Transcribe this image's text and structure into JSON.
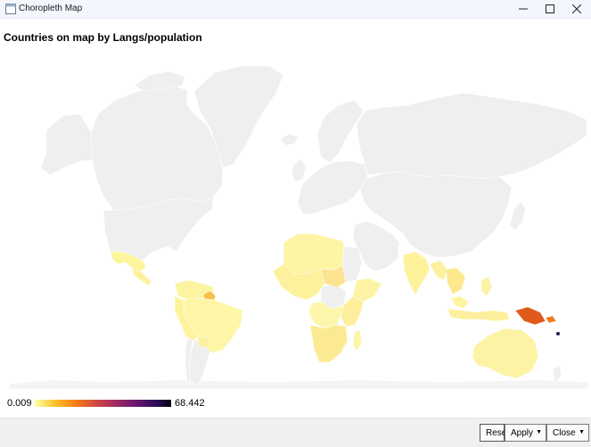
{
  "window": {
    "title": "Choropleth Map",
    "controls": [
      "minimize",
      "maximize",
      "close"
    ]
  },
  "map": {
    "title": "Countries on map by Langs/population",
    "base_color": "#efefef",
    "border_color": "#ffffff"
  },
  "legend": {
    "min_label": "0.009",
    "max_label": "68.442",
    "colormap": "inferno_r"
  },
  "buttons": {
    "reset": "Reset",
    "apply": "Apply",
    "close": "Close"
  }
}
